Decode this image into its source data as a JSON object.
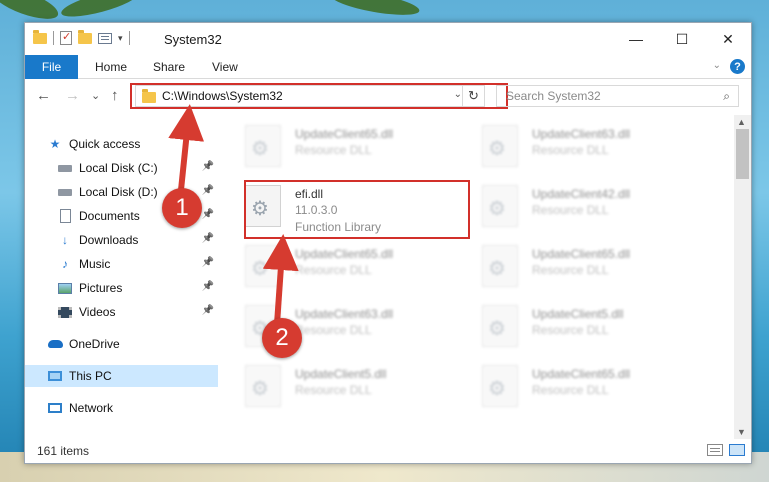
{
  "window": {
    "title": "System32",
    "controls": {
      "minimize": "—",
      "maximize": "☐",
      "close": "✕"
    }
  },
  "ribbon": {
    "tabs": [
      "File",
      "Home",
      "Share",
      "View"
    ],
    "help": "?"
  },
  "navigation": {
    "back": "←",
    "forward": "→",
    "recent": "⌄",
    "up": "↑",
    "address": "C:\\Windows\\System32",
    "refresh": "↻",
    "search_placeholder": "Search System32"
  },
  "sidebar": {
    "items": [
      {
        "label": "Quick access",
        "icon": "star-icon",
        "pinned": false
      },
      {
        "label": "Local Disk (C:)",
        "icon": "drive-icon",
        "pinned": true
      },
      {
        "label": "Local Disk (D:)",
        "icon": "drive-icon",
        "pinned": true
      },
      {
        "label": "Documents",
        "icon": "document-icon",
        "pinned": true
      },
      {
        "label": "Downloads",
        "icon": "download-icon",
        "pinned": true
      },
      {
        "label": "Music",
        "icon": "music-icon",
        "pinned": true
      },
      {
        "label": "Pictures",
        "icon": "picture-icon",
        "pinned": true
      },
      {
        "label": "Videos",
        "icon": "video-icon",
        "pinned": true
      },
      {
        "label": "OneDrive",
        "icon": "cloud-icon",
        "pinned": false
      },
      {
        "label": "This PC",
        "icon": "computer-icon",
        "pinned": false,
        "selected": true
      },
      {
        "label": "Network",
        "icon": "network-icon",
        "pinned": false
      }
    ]
  },
  "files": [
    {
      "name": "UpdateClient65.dll",
      "type": "Resource DLL",
      "blurred": true
    },
    {
      "name": "UpdateClient63.dll",
      "type": "Resource DLL",
      "blurred": true
    },
    {
      "name": "efi.dll",
      "version": "11.0.3.0",
      "type": "Function Library",
      "blurred": false
    },
    {
      "name": "UpdateClient42.dll",
      "type": "Resource DLL",
      "blurred": true
    },
    {
      "name": "UpdateClient65.dll",
      "type": "Resource DLL",
      "blurred": true
    },
    {
      "name": "UpdateClient65.dll",
      "type": "Resource DLL",
      "blurred": true
    },
    {
      "name": "UpdateClient63.dll",
      "type": "Resource DLL",
      "blurred": true
    },
    {
      "name": "UpdateClient5.dll",
      "type": "Resource DLL",
      "blurred": true
    },
    {
      "name": "UpdateClient5.dll",
      "type": "Resource DLL",
      "blurred": true
    },
    {
      "name": "UpdateClient65.dll",
      "type": "Resource DLL",
      "blurred": true
    }
  ],
  "status": {
    "item_count": "161 items"
  },
  "annotations": {
    "step1": "1",
    "step2": "2",
    "color": "#d63b30"
  }
}
